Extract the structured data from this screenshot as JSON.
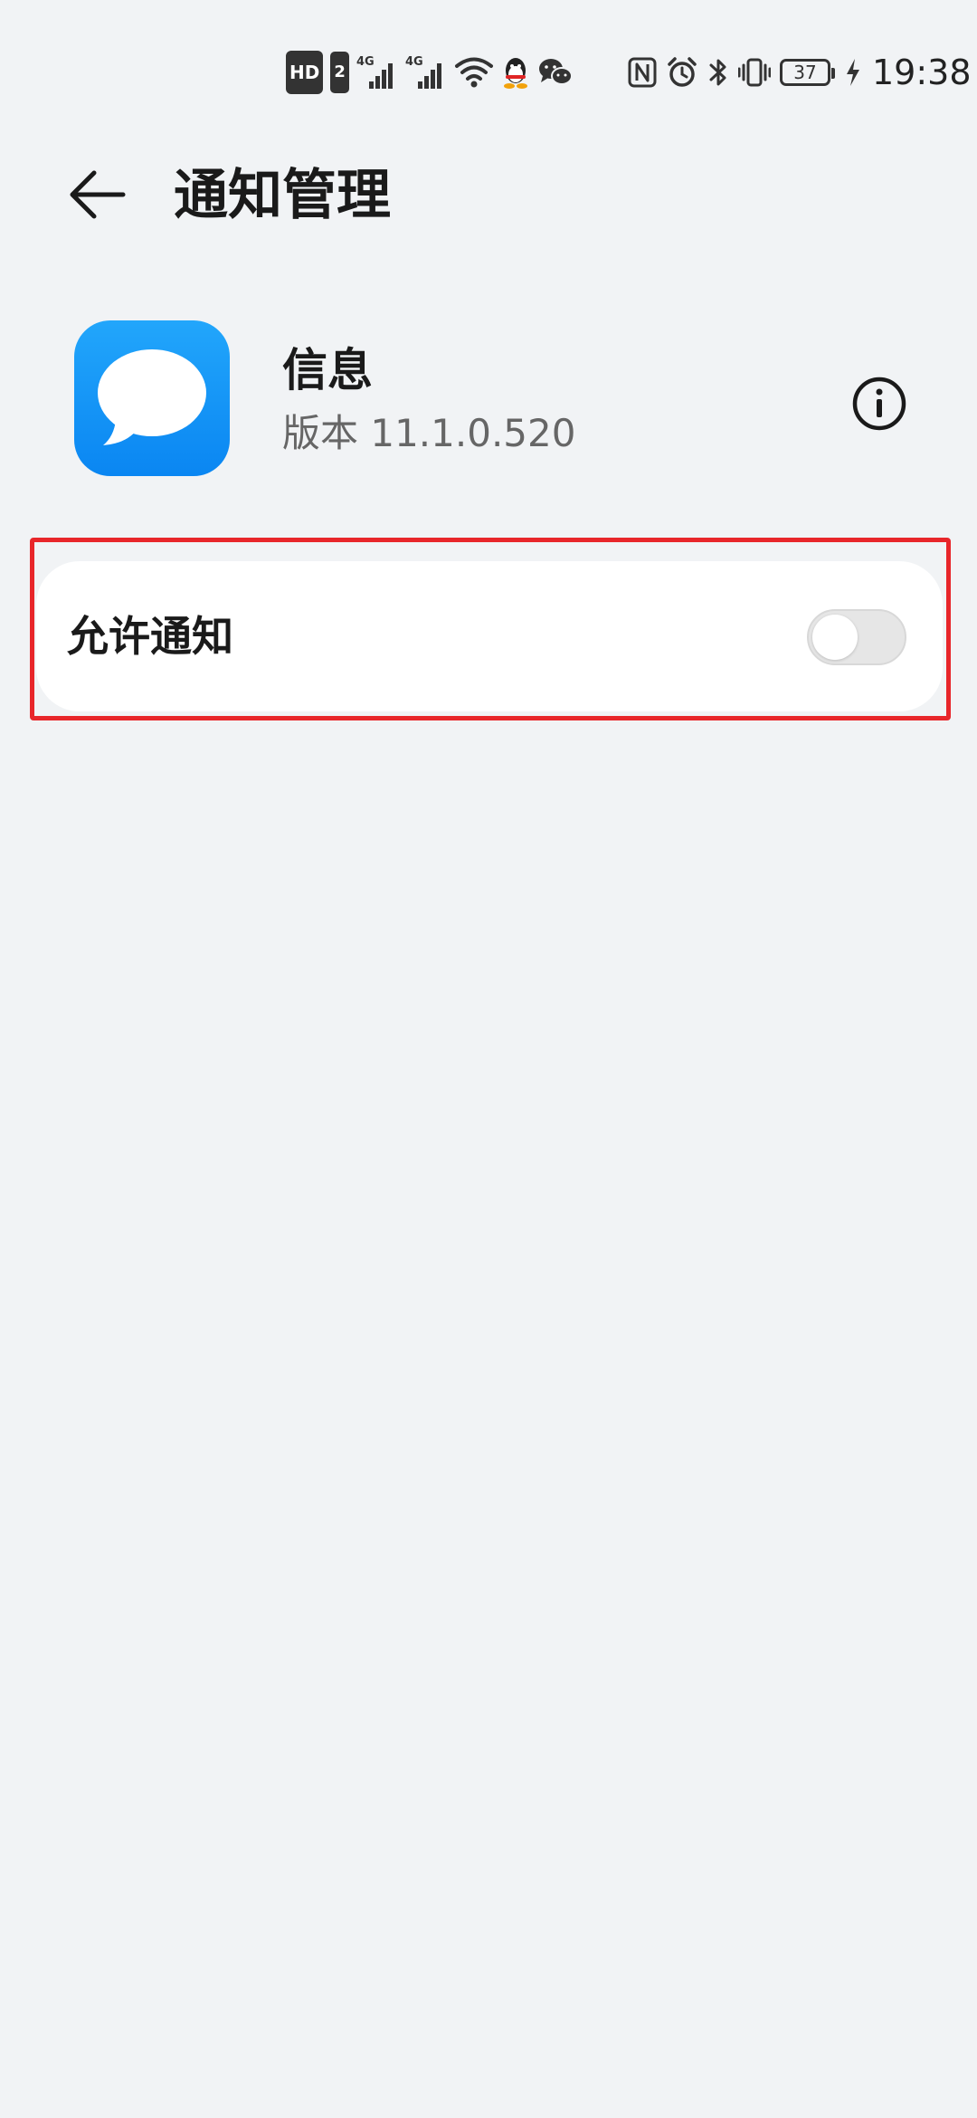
{
  "status_bar": {
    "hd_label": "HD",
    "sim_label": "2",
    "network_1": "4G",
    "network_2": "4G",
    "battery_level": "37",
    "time": "19:38",
    "left_icons": [
      "hd-icon",
      "sim-icon",
      "signal-4g-icon",
      "signal-4g-icon",
      "wifi-icon",
      "qq-icon",
      "wechat-icon"
    ],
    "right_icons": [
      "nfc-icon",
      "alarm-icon",
      "bluetooth-icon",
      "vibrate-icon",
      "battery-icon",
      "charging-icon"
    ]
  },
  "header": {
    "title": "通知管理",
    "back_icon": "arrow-left-icon"
  },
  "app": {
    "name": "信息",
    "version": "版本 11.1.0.520",
    "icon": "message-bubble-icon",
    "icon_color": "#1a97f7",
    "info_icon": "info-circle-icon"
  },
  "settings": {
    "allow_notifications_label": "允许通知",
    "allow_notifications_enabled": false
  },
  "colors": {
    "background": "#f1f3f5",
    "card": "#ffffff",
    "highlight": "#e8262a"
  }
}
